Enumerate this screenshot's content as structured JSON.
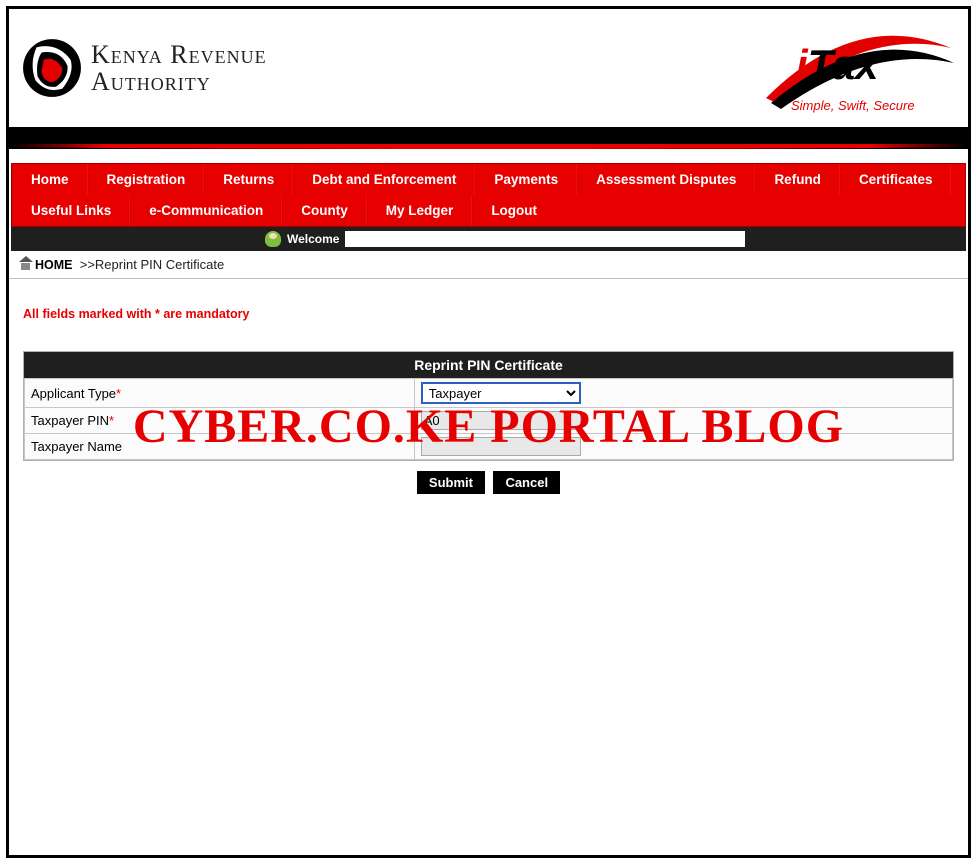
{
  "header": {
    "org_line1": "Kenya Revenue",
    "org_line2": "Authority",
    "itax_label": "iTax",
    "itax_tagline": "Simple, Swift, Secure"
  },
  "nav": {
    "row1": [
      "Home",
      "Registration",
      "Returns",
      "Debt and Enforcement",
      "Payments",
      "Assessment Disputes",
      "Refund",
      "Certificates",
      "Useful Links"
    ],
    "row2": [
      "e-Communication",
      "County",
      "My Ledger",
      "Logout"
    ]
  },
  "welcome": {
    "label": "Welcome",
    "value": ""
  },
  "breadcrumb": {
    "home": "HOME",
    "sep": ">>",
    "current": "Reprint PIN Certificate"
  },
  "mandatory_note": "All fields marked with * are mandatory",
  "form": {
    "title": "Reprint PIN Certificate",
    "fields": {
      "applicant_type": {
        "label": "Applicant Type",
        "required": true,
        "value": "Taxpayer"
      },
      "taxpayer_pin": {
        "label": "Taxpayer PIN",
        "required": true,
        "value": "A0"
      },
      "taxpayer_name": {
        "label": "Taxpayer Name",
        "required": false,
        "value": ""
      }
    },
    "buttons": {
      "submit": "Submit",
      "cancel": "Cancel"
    }
  },
  "watermark": "CYBER.CO.KE PORTAL BLOG"
}
